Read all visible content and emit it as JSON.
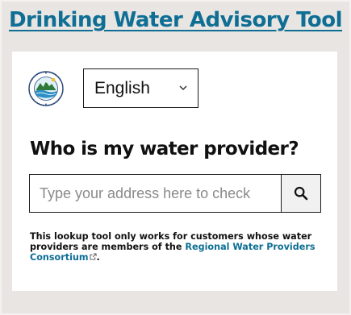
{
  "header": {
    "title": "Drinking Water Advisory Tool"
  },
  "logo": {
    "text": "REGIONAL WATER PROVIDERS CONSORTIUM",
    "icon": "consortium-logo"
  },
  "language": {
    "selected": "English"
  },
  "lookup": {
    "question": "Who is my water provider?",
    "placeholder": "Type your address here to check",
    "value": "",
    "search_icon": "search-icon"
  },
  "note": {
    "text_before": "This lookup tool only works for customers whose water providers are members of the ",
    "link_text": "Regional Water Providers Consortium",
    "text_after": "."
  },
  "colors": {
    "accent": "#0e6e94",
    "background": "#e8e5e3",
    "card": "#ffffff"
  }
}
